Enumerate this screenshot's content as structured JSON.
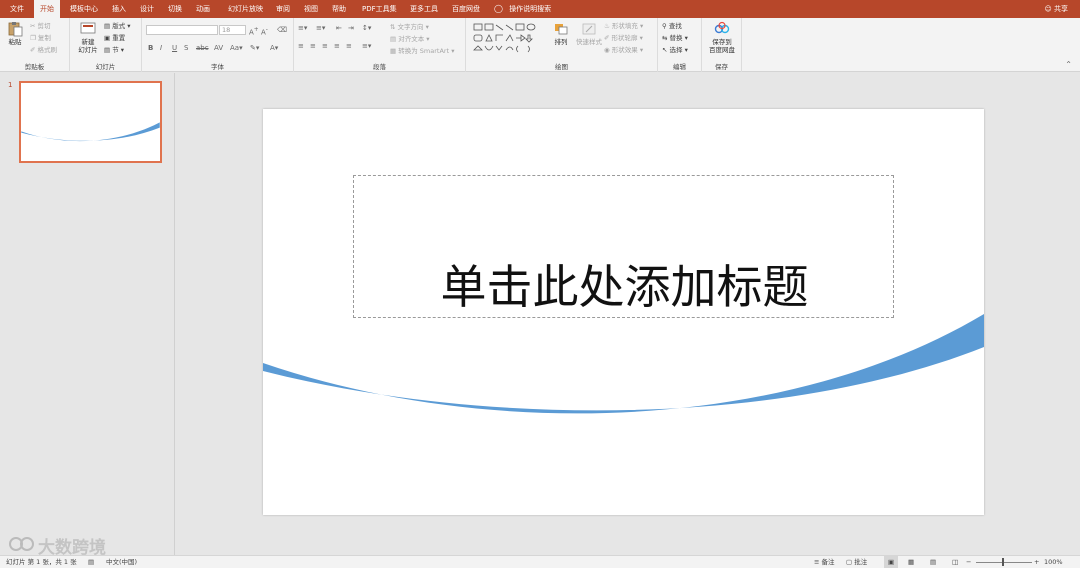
{
  "tabs": [
    {
      "label": "文件",
      "active": false
    },
    {
      "label": "开始",
      "active": true
    },
    {
      "label": "模板中心",
      "active": false
    },
    {
      "label": "插入",
      "active": false
    },
    {
      "label": "设计",
      "active": false
    },
    {
      "label": "切换",
      "active": false
    },
    {
      "label": "动画",
      "active": false
    },
    {
      "label": "幻灯片放映",
      "active": false
    },
    {
      "label": "审阅",
      "active": false
    },
    {
      "label": "视图",
      "active": false
    },
    {
      "label": "帮助",
      "active": false
    },
    {
      "label": "PDF工具集",
      "active": false
    },
    {
      "label": "更多工具",
      "active": false
    },
    {
      "label": "百度网盘",
      "active": false
    }
  ],
  "tell_me": "操作说明搜索",
  "share": "共享",
  "ribbon": {
    "clipboard": {
      "paste": "粘贴",
      "cut": "剪切",
      "copy": "复制",
      "format_painter": "格式刷",
      "label": "剪贴板"
    },
    "slides": {
      "new_slide": "新建\n幻灯片",
      "layout": "版式",
      "reset": "重置",
      "section": "节",
      "label": "幻灯片"
    },
    "font": {
      "size": "18",
      "label": "字体"
    },
    "paragraph": {
      "text_direction": "文字方向",
      "align_text": "对齐文本",
      "smartart": "转换为 SmartArt",
      "label": "段落"
    },
    "drawing": {
      "arrange": "排列",
      "quick_styles": "快速样式",
      "shape_fill": "形状填充",
      "shape_outline": "形状轮廓",
      "shape_effects": "形状效果",
      "label": "绘图"
    },
    "editing": {
      "find": "查找",
      "replace": "替换",
      "select": "选择",
      "label": "编辑"
    },
    "save": {
      "save_to": "保存到\n百度网盘",
      "label": "保存"
    }
  },
  "thumbnails": [
    {
      "number": "1"
    }
  ],
  "slide": {
    "title_placeholder": "单击此处添加标题"
  },
  "statusbar": {
    "slide_info": "幻灯片 第 1 张，共 1 张",
    "language": "中文(中国)",
    "notes": "备注",
    "comments": "批注",
    "zoom": "100%"
  },
  "watermark": "大数跨境",
  "colors": {
    "accent": "#b7472a",
    "slide_curve": "#5b9bd5",
    "thumb_border": "#e0734e"
  }
}
